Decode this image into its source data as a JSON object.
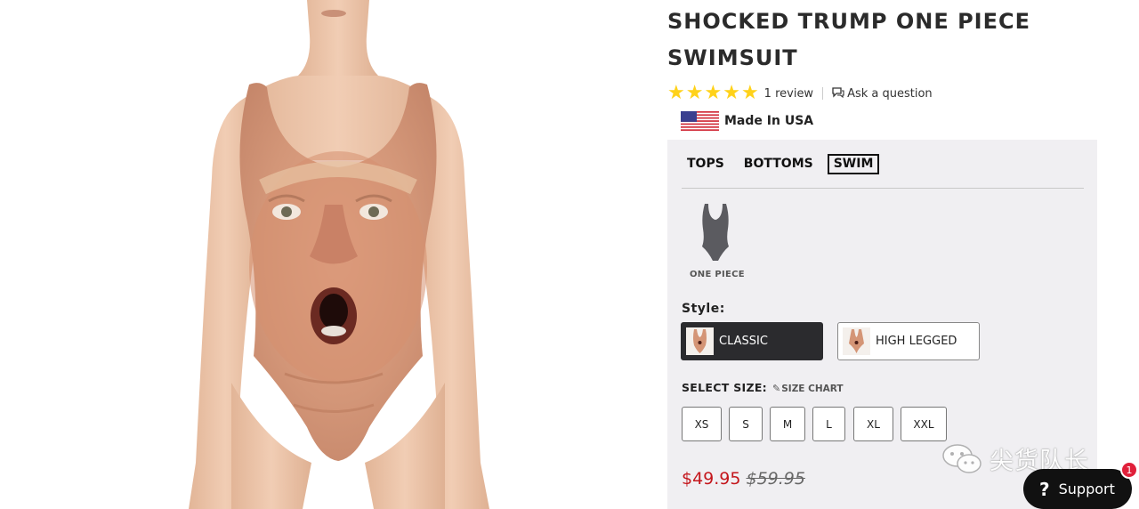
{
  "product": {
    "title": "SHOCKED TRUMP ONE PIECE SWIMSUIT",
    "rating": {
      "stars": 5,
      "review_link": "1 review"
    },
    "ask_question": "Ask a question",
    "origin": "Made In USA",
    "image_alt": "Woman wearing one piece swimsuit printed with a shocked face"
  },
  "categories": {
    "tabs": [
      {
        "label": "TOPS",
        "active": false
      },
      {
        "label": "BOTTOMS",
        "active": false
      },
      {
        "label": "SWIM",
        "active": true
      }
    ]
  },
  "cut": {
    "label": "ONE PIECE"
  },
  "style": {
    "label": "Style:",
    "options": [
      {
        "label": "CLASSIC",
        "selected": true
      },
      {
        "label": "HIGH LEGGED",
        "selected": false
      }
    ]
  },
  "size": {
    "label": "SELECT SIZE:",
    "chart_link": "SIZE CHART",
    "options": [
      "XS",
      "S",
      "M",
      "L",
      "XL",
      "XXL"
    ]
  },
  "price": {
    "current": "$49.95",
    "original": "$59.95"
  },
  "watermark": {
    "text": "尖货队长"
  },
  "support": {
    "label": "Support",
    "icon": "?",
    "badge": "1"
  },
  "colors": {
    "star": "#ffd21a",
    "price": "#c4161c",
    "panel": "#f0eff2",
    "selected_style": "#2b2b2e"
  },
  "icons": [
    "star-icon",
    "speech-bubble-icon",
    "us-flag-icon",
    "pencil-icon",
    "wechat-icon",
    "help-icon"
  ]
}
